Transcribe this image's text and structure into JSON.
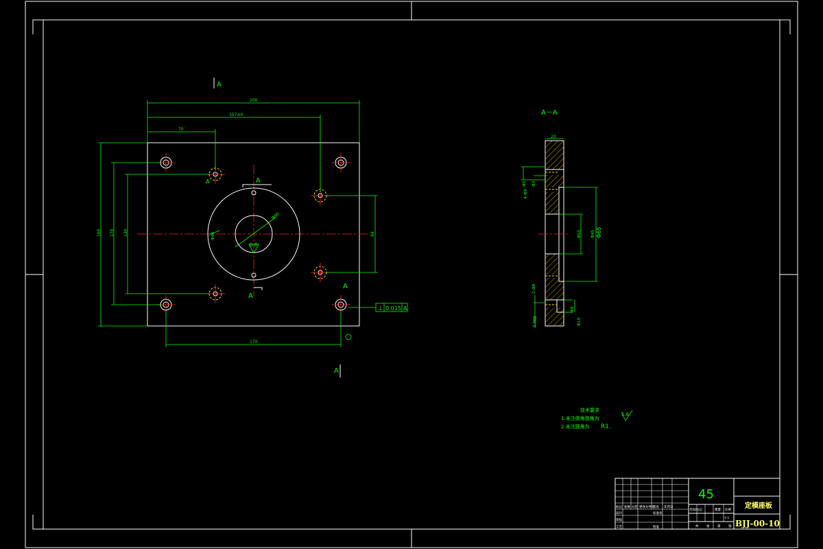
{
  "section_markers": {
    "top": "A",
    "bottom": "A",
    "left_hole": "A",
    "center_top": "A",
    "center_bottom": "A",
    "right_lower": "A"
  },
  "section_view": {
    "title": "A－A"
  },
  "dimensions": {
    "top_overall": "200",
    "top_mid": "157±0",
    "top_left": "70",
    "left_outer": "160",
    "left_mid": "170",
    "left_inner": "130",
    "right_span": "84",
    "bottom_width": "170",
    "center_dia": "Φ90",
    "bore_dia": "Φ40",
    "roughness_center": "0.8",
    "sec_top": "20",
    "sec_left1": "Φ5",
    "sec_left2": "Φ3",
    "sec_left3": "4-Φ9",
    "sec_mid": "Φ65",
    "sec_mid2": "Φ55",
    "sec_right": "Φ45",
    "sec_bot1": "2-Φ8",
    "sec_bot2": "4-M8",
    "sec_bot3": "Φ8",
    "sec_bot4": "Φ10"
  },
  "tolerance_frame": {
    "symbol": "⊥",
    "value": "0.015",
    "datum": "A"
  },
  "technical_notes": {
    "heading": "技术要求",
    "line1": "1.未注倒角倒角为",
    "line2": "2.未注圆角为",
    "line2_value": "R1.",
    "roughness": "1.6"
  },
  "title_block": {
    "material": "45",
    "part_name": "定模座板",
    "drawing_no": "BJJ-00-10",
    "scale": "1:1",
    "row_labels": [
      "标记",
      "处数",
      "分区",
      "更改文件号",
      "签名",
      "年月日"
    ],
    "side_labels": [
      "设计",
      "审核",
      "工艺"
    ],
    "stage_labels": [
      "阶段标记",
      "重量",
      "比例"
    ],
    "sheet_labels": [
      "共",
      "张",
      "第",
      "张"
    ],
    "approve_label": "批准",
    "std_label": "标准化"
  }
}
